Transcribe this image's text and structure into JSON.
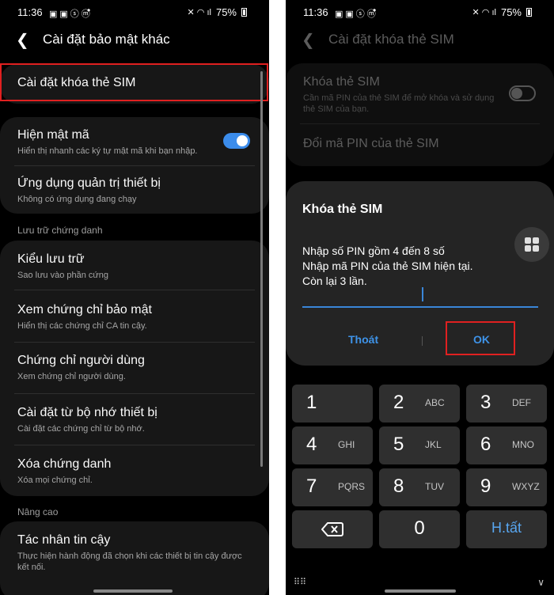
{
  "status_bar": {
    "time": "11:36",
    "battery": "75%"
  },
  "left": {
    "title": "Cài đặt bảo mật khác",
    "items": [
      {
        "title": "Cài đặt khóa thẻ SIM"
      },
      {
        "title": "Hiện mật mã",
        "subtitle": "Hiển thị nhanh các ký tự mật mã khi bạn nhập.",
        "toggle_on": true
      },
      {
        "title": "Ứng dụng quản trị thiết bị",
        "subtitle": "Không có ứng dụng đang chạy"
      },
      {
        "title": "Kiểu lưu trữ",
        "subtitle": "Sao lưu vào phần cứng"
      },
      {
        "title": "Xem chứng chỉ bảo mật",
        "subtitle": "Hiển thị các chứng chỉ CA tin cậy."
      },
      {
        "title": "Chứng chỉ người dùng",
        "subtitle": "Xem chứng chỉ người dùng."
      },
      {
        "title": "Cài đặt từ bộ nhớ thiết bị",
        "subtitle": "Cài đặt các chứng chỉ từ bộ nhớ."
      },
      {
        "title": "Xóa chứng danh",
        "subtitle": "Xóa mọi chứng chỉ."
      },
      {
        "title": "Tác nhân tin cậy",
        "subtitle": "Thực hiện hành động đã chọn khi các thiết bị tin cậy được kết nối."
      }
    ],
    "sections": [
      "Lưu trữ chứng danh",
      "Nâng cao"
    ]
  },
  "right": {
    "title": "Cài đặt khóa thẻ SIM",
    "items": [
      {
        "title": "Khóa thẻ SIM",
        "subtitle": "Cần mã PIN của thẻ SIM để mở khóa và sử dụng thẻ SIM của bạn.",
        "toggle_on": false
      },
      {
        "title": "Đổi mã PIN của thẻ SIM"
      }
    ],
    "dialog": {
      "title": "Khóa thẻ SIM",
      "lines": [
        "Nhập số PIN gồm 4 đến 8 số",
        "Nhập mã PIN của thẻ SIM hiện tại.",
        "Còn lại 3 lần."
      ],
      "cancel": "Thoát",
      "ok": "OK"
    },
    "keypad": {
      "keys": [
        {
          "num": "1",
          "letters": ""
        },
        {
          "num": "2",
          "letters": "ABC"
        },
        {
          "num": "3",
          "letters": "DEF"
        },
        {
          "num": "4",
          "letters": "GHI"
        },
        {
          "num": "5",
          "letters": "JKL"
        },
        {
          "num": "6",
          "letters": "MNO"
        },
        {
          "num": "7",
          "letters": "PQRS"
        },
        {
          "num": "8",
          "letters": "TUV"
        },
        {
          "num": "9",
          "letters": "WXYZ"
        },
        {
          "num": "0",
          "letters": ""
        }
      ],
      "done": "H.tất"
    }
  },
  "colors": {
    "accent": "#3e93e8",
    "highlight": "#e02020",
    "toggle_on": "#3b8ceb"
  }
}
